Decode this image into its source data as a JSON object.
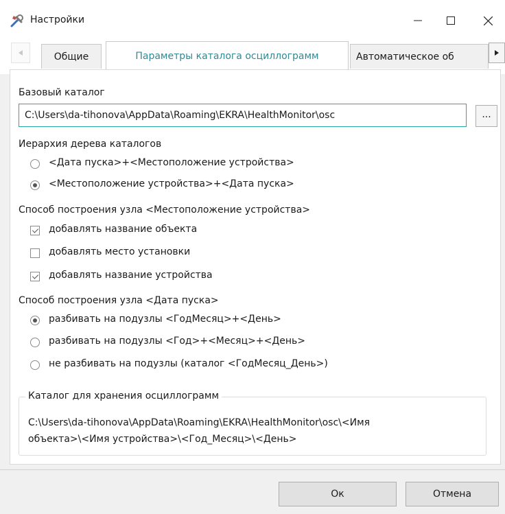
{
  "window": {
    "title": "Настройки"
  },
  "tabs": [
    {
      "label": "Общие"
    },
    {
      "label": "Параметры каталога осциллограмм"
    },
    {
      "label": "Автоматическое об"
    }
  ],
  "base_dir": {
    "label": "Базовый каталог",
    "value": "C:\\Users\\da-tihonova\\AppData\\Roaming\\EKRA\\HealthMonitor\\osc",
    "browse_label": "..."
  },
  "hierarchy": {
    "label": "Иерархия дерева каталогов",
    "options": [
      {
        "label": "<Дата пуска>+<Местоположение устройства>",
        "selected": false
      },
      {
        "label": "<Местоположение устройства>+<Дата пуска>",
        "selected": true
      }
    ]
  },
  "location_node": {
    "label": "Способ построения узла <Местоположение устройства>",
    "options": [
      {
        "label": "добавлять название объекта",
        "checked": true
      },
      {
        "label": "добавлять место установки",
        "checked": false
      },
      {
        "label": "добавлять название устройства",
        "checked": true
      }
    ]
  },
  "date_node": {
    "label": "Способ построения узла <Дата пуска>",
    "options": [
      {
        "label": "разбивать на подузлы <ГодМесяц>+<День>",
        "selected": true
      },
      {
        "label": "разбивать на подузлы <Год>+<Месяц>+<День>",
        "selected": false
      },
      {
        "label": "не разбивать на подузлы (каталог <ГодМесяц_День>)",
        "selected": false
      }
    ]
  },
  "storage": {
    "title": "Каталог для хранения осциллограмм",
    "line1": "C:\\Users\\da-tihonova\\AppData\\Roaming\\EKRA\\HealthMonitor\\osc\\<Имя",
    "line2": "объекта>\\<Имя устройства>\\<Год_Месяц>\\<День>"
  },
  "buttons": {
    "ok": "Ок",
    "cancel": "Отмена"
  }
}
